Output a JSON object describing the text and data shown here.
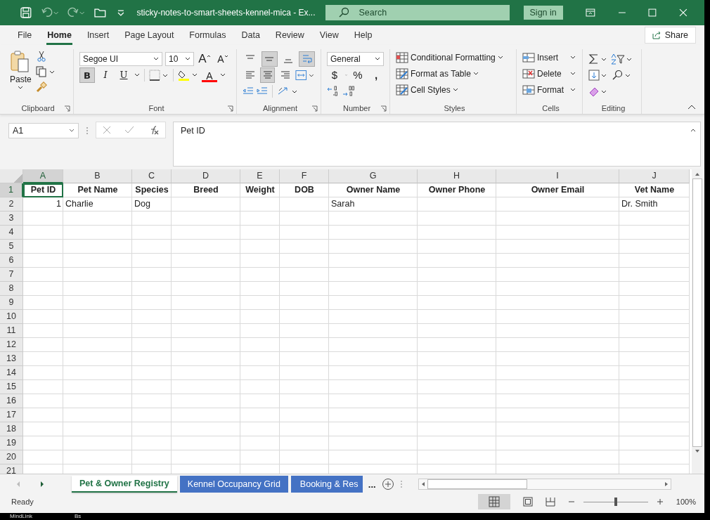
{
  "window": {
    "title": "sticky-notes-to-smart-sheets-kennel-mica  -  Ex...",
    "search": {
      "placeholder": "Search"
    },
    "sign_in": "Sign in"
  },
  "menu": [
    {
      "label": "File",
      "selected": false
    },
    {
      "label": "Home",
      "selected": true
    },
    {
      "label": "Insert",
      "selected": false
    },
    {
      "label": "Page Layout",
      "selected": false
    },
    {
      "label": "Formulas",
      "selected": false
    },
    {
      "label": "Data",
      "selected": false
    },
    {
      "label": "Review",
      "selected": false
    },
    {
      "label": "View",
      "selected": false
    },
    {
      "label": "Help",
      "selected": false
    }
  ],
  "share": "Share",
  "ribbon": {
    "clipboard": {
      "paste": "Paste",
      "label": "Clipboard"
    },
    "font": {
      "name": "Segoe UI",
      "size": "10",
      "grow": "A",
      "shrink": "A",
      "color_glyph": "A",
      "label": "Font",
      "styles": [
        {
          "label": "B",
          "selected": true
        },
        {
          "label": "I",
          "selected": false
        },
        {
          "label": "U",
          "selected": false
        }
      ]
    },
    "alignment": {
      "label": "Alignment",
      "vertical": [
        {
          "selected": false
        },
        {
          "selected": true
        },
        {
          "selected": false
        }
      ],
      "horizontal": [
        {
          "selected": false
        },
        {
          "selected": true
        },
        {
          "selected": false
        }
      ],
      "wrap_selected": true
    },
    "number": {
      "format": "General",
      "currency": "$",
      "percent": "%",
      "comma": ",",
      "label": "Number"
    },
    "styles": {
      "items": [
        "Conditional Formatting",
        "Format as Table",
        "Cell Styles"
      ],
      "label": "Styles"
    },
    "cells": {
      "items": [
        "Insert",
        "Delete",
        "Format"
      ],
      "label": "Cells"
    },
    "editing": {
      "label": "Editing"
    }
  },
  "name_box": "A1",
  "formula": "Pet ID",
  "columns": [
    {
      "letter": "A",
      "selected": true
    },
    {
      "letter": "B",
      "selected": false
    },
    {
      "letter": "C",
      "selected": false
    },
    {
      "letter": "D",
      "selected": false
    },
    {
      "letter": "E",
      "selected": false
    },
    {
      "letter": "F",
      "selected": false
    },
    {
      "letter": "G",
      "selected": false
    },
    {
      "letter": "H",
      "selected": false
    },
    {
      "letter": "I",
      "selected": false
    },
    {
      "letter": "J",
      "selected": false
    }
  ],
  "rows": [
    {
      "number": "1",
      "selected": true,
      "cells": [
        "Pet ID",
        "Pet Name",
        "Species",
        "Breed",
        "Weight",
        "DOB",
        "Owner Name",
        "Owner Phone",
        "Owner Email",
        "Vet Name"
      ]
    },
    {
      "number": "2",
      "selected": false,
      "cells": [
        "1",
        "Charlie",
        "Dog",
        "",
        "",
        "",
        "Sarah",
        "",
        "",
        "Dr. Smith"
      ]
    },
    {
      "number": "3",
      "selected": false,
      "cells": []
    },
    {
      "number": "4",
      "selected": false,
      "cells": []
    },
    {
      "number": "5",
      "selected": false,
      "cells": []
    },
    {
      "number": "6",
      "selected": false,
      "cells": []
    },
    {
      "number": "7",
      "selected": false,
      "cells": []
    },
    {
      "number": "8",
      "selected": false,
      "cells": []
    },
    {
      "number": "9",
      "selected": false,
      "cells": []
    },
    {
      "number": "10",
      "selected": false,
      "cells": []
    },
    {
      "number": "11",
      "selected": false,
      "cells": []
    },
    {
      "number": "12",
      "selected": false,
      "cells": []
    },
    {
      "number": "13",
      "selected": false,
      "cells": []
    },
    {
      "number": "14",
      "selected": false,
      "cells": []
    },
    {
      "number": "15",
      "selected": false,
      "cells": []
    },
    {
      "number": "16",
      "selected": false,
      "cells": []
    },
    {
      "number": "17",
      "selected": false,
      "cells": []
    },
    {
      "number": "18",
      "selected": false,
      "cells": []
    },
    {
      "number": "19",
      "selected": false,
      "cells": []
    },
    {
      "number": "20",
      "selected": false,
      "cells": []
    },
    {
      "number": "21",
      "selected": false,
      "cells": []
    }
  ],
  "sheets": [
    {
      "label": "Pet & Owner Registry",
      "selected": true
    },
    {
      "label": "Kennel Occupancy Grid",
      "selected": false
    },
    {
      "label": "Booking & Res",
      "selected": false
    }
  ],
  "more_sheets": "...",
  "status": {
    "text": "Ready",
    "zoom": "100%",
    "level": 0.5
  },
  "desktop": [
    "MindLink",
    "Bs"
  ]
}
